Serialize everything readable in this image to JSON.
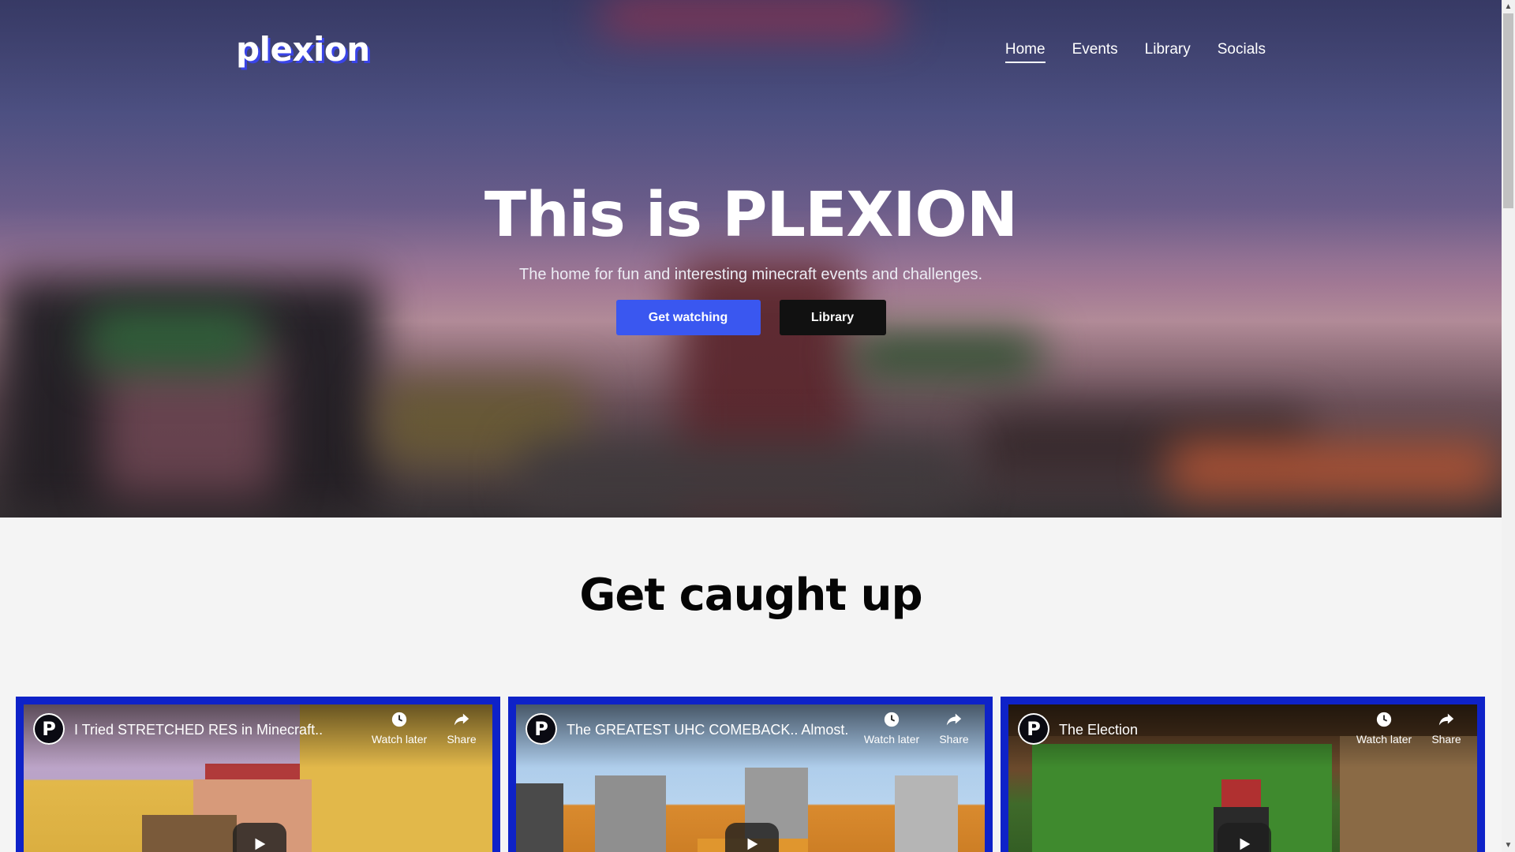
{
  "brand": {
    "logo": "plexion"
  },
  "nav": {
    "items": [
      {
        "label": "Home",
        "active": true
      },
      {
        "label": "Events",
        "active": false
      },
      {
        "label": "Library",
        "active": false
      },
      {
        "label": "Socials",
        "active": false
      }
    ]
  },
  "hero": {
    "title": "This is PLEXION",
    "subtitle": "The home for fun and interesting minecraft events and challenges.",
    "primary_button": "Get watching",
    "secondary_button": "Library"
  },
  "section": {
    "title": "Get caught up"
  },
  "videos": [
    {
      "channel_icon": "P",
      "title": "I Tried STRETCHED RES in Minecraft..",
      "watch_later": "Watch later",
      "share": "Share",
      "thumb_colors": [
        "#c9a7c4",
        "#e2b84a",
        "#b03a3a"
      ]
    },
    {
      "channel_icon": "P",
      "title": "The GREATEST UHC COMEBACK.. Almost.",
      "watch_later": "Watch later",
      "share": "Share",
      "thumb_colors": [
        "#9fc2e6",
        "#8f8f8f",
        "#d98a2e"
      ]
    },
    {
      "channel_icon": "P",
      "title": "The Election",
      "watch_later": "Watch later",
      "share": "Share",
      "thumb_colors": [
        "#6b4a2c",
        "#3f8a2e",
        "#8a6a45"
      ]
    }
  ],
  "colors": {
    "accent": "#3a57f0",
    "card_border": "#0e22c8",
    "dark_button": "#111111",
    "page_bg": "#f4f4f4"
  }
}
